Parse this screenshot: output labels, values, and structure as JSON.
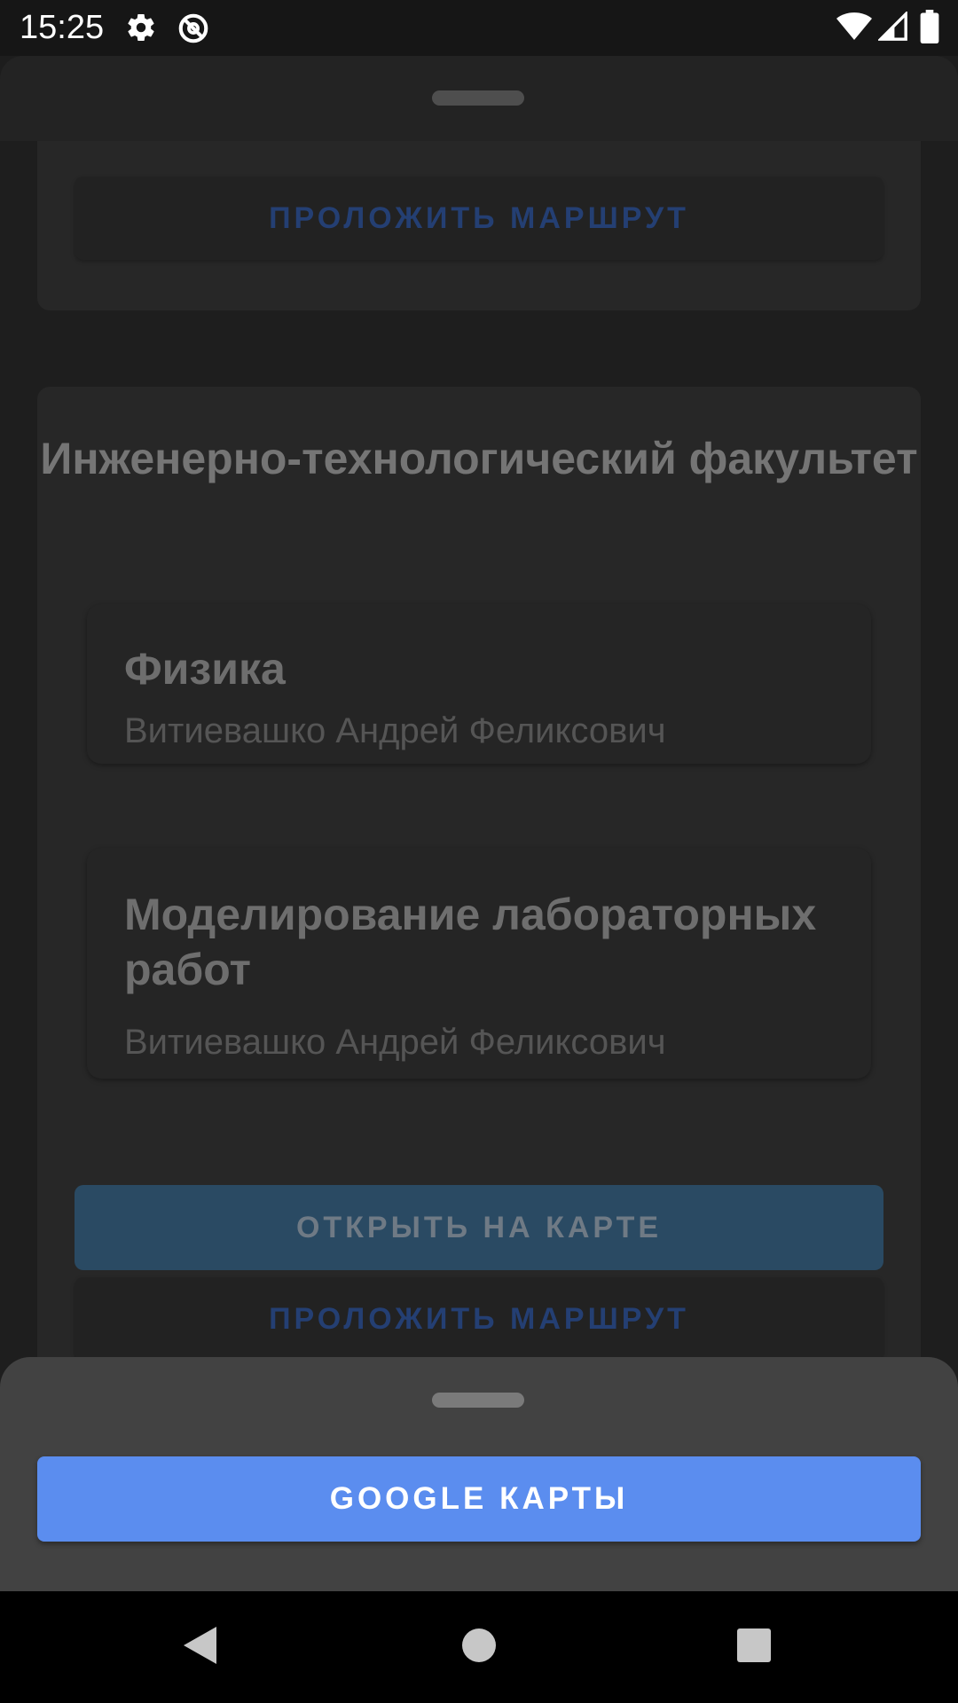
{
  "status_bar": {
    "time": "15:25",
    "icons": [
      "gear-icon",
      "location-off-icon",
      "wifi-icon",
      "signal-icon",
      "battery-icon"
    ]
  },
  "underlay": {
    "route_button_top_label": "ПРОЛОЖИТЬ МАРШРУТ",
    "faculty": {
      "title": "Инженерно-технологический факультет",
      "subjects": [
        {
          "title": "Физика",
          "teacher": "Витиевашко Андрей Феликсович"
        },
        {
          "title": "Моделирование лабораторных работ",
          "teacher": "Витиевашко Андрей Феликсович"
        }
      ],
      "open_map_label": "ОТКРЫТЬ НА КАРТЕ",
      "route_label": "ПРОЛОЖИТЬ МАРШРУТ"
    }
  },
  "chooser": {
    "google_maps_label": "GOOGLE КАРТЫ"
  },
  "colors": {
    "accent": "#5b8def",
    "status_bar": "#161616",
    "sheet": "#424242"
  },
  "nav": {
    "icons": [
      "back-icon",
      "home-icon",
      "recents-icon"
    ]
  }
}
